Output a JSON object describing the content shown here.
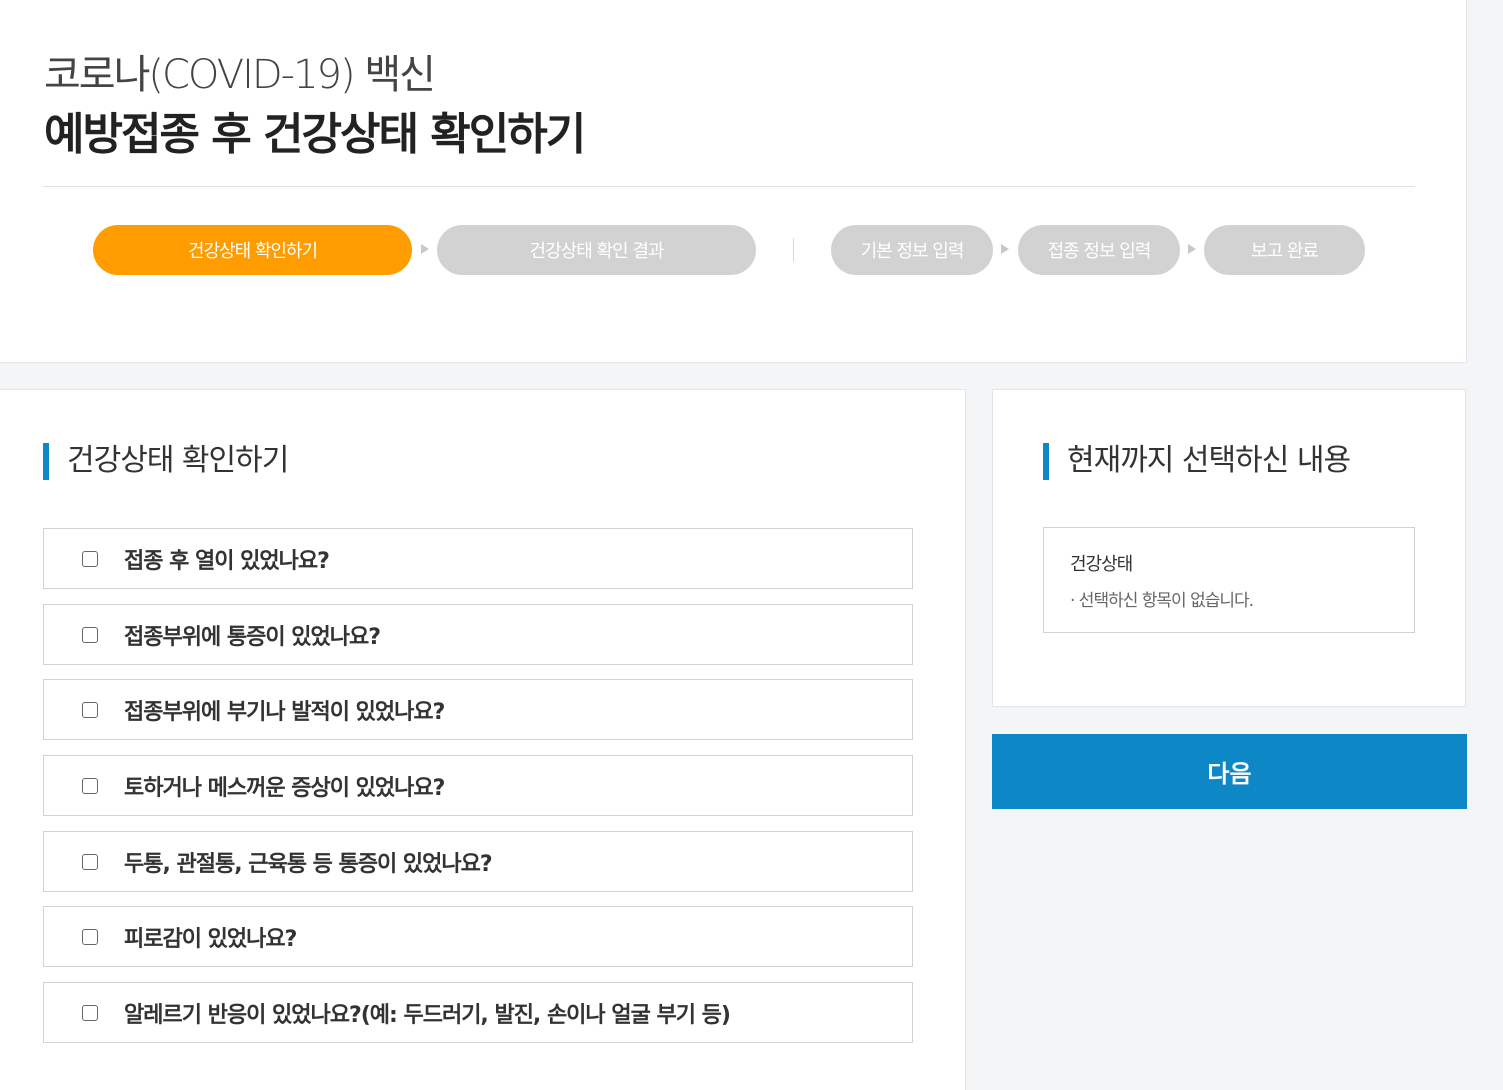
{
  "header": {
    "title_line1": "코로나(COVID-19) 백신",
    "title_line2": "예방접종 후 건강상태 확인하기"
  },
  "steps": [
    {
      "label": "건강상태 확인하기",
      "active": true
    },
    {
      "label": "건강상태 확인 결과",
      "active": false
    },
    {
      "label": "기본 정보 입력",
      "active": false
    },
    {
      "label": "접종 정보 입력",
      "active": false
    },
    {
      "label": "보고 완료",
      "active": false
    }
  ],
  "checklist": {
    "title": "건강상태 확인하기",
    "items": [
      {
        "label": "접종 후 열이 있었나요?",
        "checked": false
      },
      {
        "label": "접종부위에 통증이 있었나요?",
        "checked": false
      },
      {
        "label": "접종부위에 부기나 발적이 있었나요?",
        "checked": false
      },
      {
        "label": "토하거나 메스꺼운 증상이 있었나요?",
        "checked": false
      },
      {
        "label": "두통, 관절통, 근육통 등 통증이 있었나요?",
        "checked": false
      },
      {
        "label": "피로감이 있었나요?",
        "checked": false
      },
      {
        "label": "알레르기 반응이 있었나요?(예: 두드러기, 발진, 손이나 얼굴 부기 등)",
        "checked": false
      }
    ]
  },
  "summary": {
    "title": "현재까지 선택하신 내용",
    "category_label": "건강상태",
    "empty_text": "· 선택하신 항목이 없습니다."
  },
  "next_button": {
    "label": "다음"
  },
  "colors": {
    "active_step": "#ff9c00",
    "inactive_step": "#d2d2d2",
    "accent": "#0e87c6",
    "background": "#f4f5f7"
  }
}
